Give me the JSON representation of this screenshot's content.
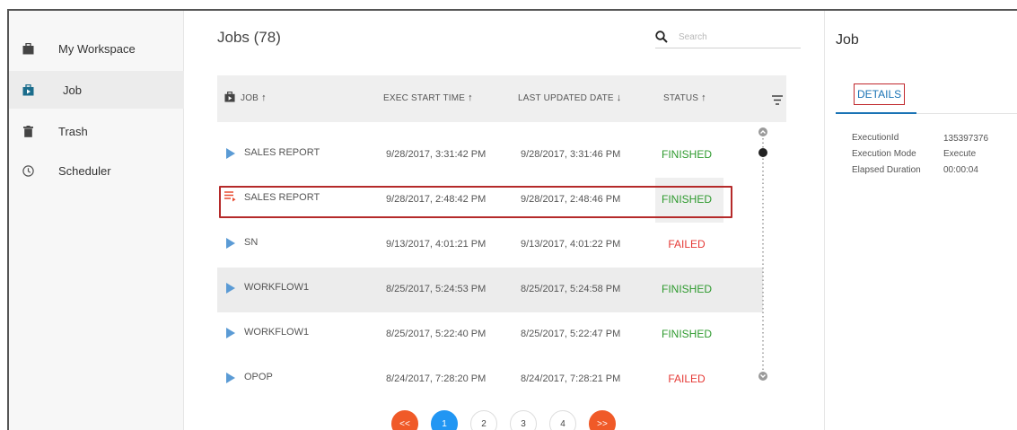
{
  "sidebar": {
    "items": [
      {
        "label": "My Workspace",
        "icon": "briefcase-icon"
      },
      {
        "label": "Job",
        "icon": "job-briefcase-icon",
        "active": true
      },
      {
        "label": "Trash",
        "icon": "trash-icon"
      },
      {
        "label": "Scheduler",
        "icon": "clock-icon"
      }
    ]
  },
  "main": {
    "title": "Jobs (78)",
    "search": {
      "placeholder": "Search",
      "value": ""
    },
    "columns": [
      {
        "label": "JOB",
        "sort": "↑"
      },
      {
        "label": "EXEC START TIME",
        "sort": "↑"
      },
      {
        "label": "LAST UPDATED DATE",
        "sort": "↓"
      },
      {
        "label": "STATUS",
        "sort": "↑"
      }
    ],
    "rows": [
      {
        "name": "SALES REPORT",
        "exec_start": "9/28/2017, 3:31:42 PM",
        "last_updated": "9/28/2017, 3:31:46 PM",
        "status": "FINISHED",
        "icon": "play-icon"
      },
      {
        "name": "SALES REPORT",
        "exec_start": "9/28/2017, 2:48:42 PM",
        "last_updated": "9/28/2017, 2:48:46 PM",
        "status": "FINISHED",
        "icon": "list-run-icon",
        "selected": true
      },
      {
        "name": "SN",
        "exec_start": "9/13/2017, 4:01:21 PM",
        "last_updated": "9/13/2017, 4:01:22 PM",
        "status": "FAILED",
        "icon": "play-icon"
      },
      {
        "name": "WORKFLOW1",
        "exec_start": "8/25/2017, 5:24:53 PM",
        "last_updated": "8/25/2017, 5:24:58 PM",
        "status": "FINISHED",
        "icon": "play-icon"
      },
      {
        "name": "WORKFLOW1",
        "exec_start": "8/25/2017, 5:22:40 PM",
        "last_updated": "8/25/2017, 5:22:47 PM",
        "status": "FINISHED",
        "icon": "play-icon"
      },
      {
        "name": "OPOP",
        "exec_start": "8/24/2017, 7:28:20 PM",
        "last_updated": "8/24/2017, 7:28:21 PM",
        "status": "FAILED",
        "icon": "play-icon"
      }
    ],
    "pagination": {
      "first": "<<",
      "pages": [
        "1",
        "2",
        "3",
        "4"
      ],
      "current": "1",
      "next": ">>"
    }
  },
  "details": {
    "title": "Job",
    "tab": "DETAILS",
    "fields": [
      {
        "key": "ExecutionId",
        "value": "135397376"
      },
      {
        "key": "Execution Mode",
        "value": "Execute"
      },
      {
        "key": "Elapsed Duration",
        "value": "00:00:04"
      }
    ]
  },
  "colors": {
    "finished": "#2e9a2e",
    "failed": "#e53935",
    "accent": "#2196f3",
    "pager_nav": "#f05a28",
    "highlight": "#b52a2a"
  }
}
